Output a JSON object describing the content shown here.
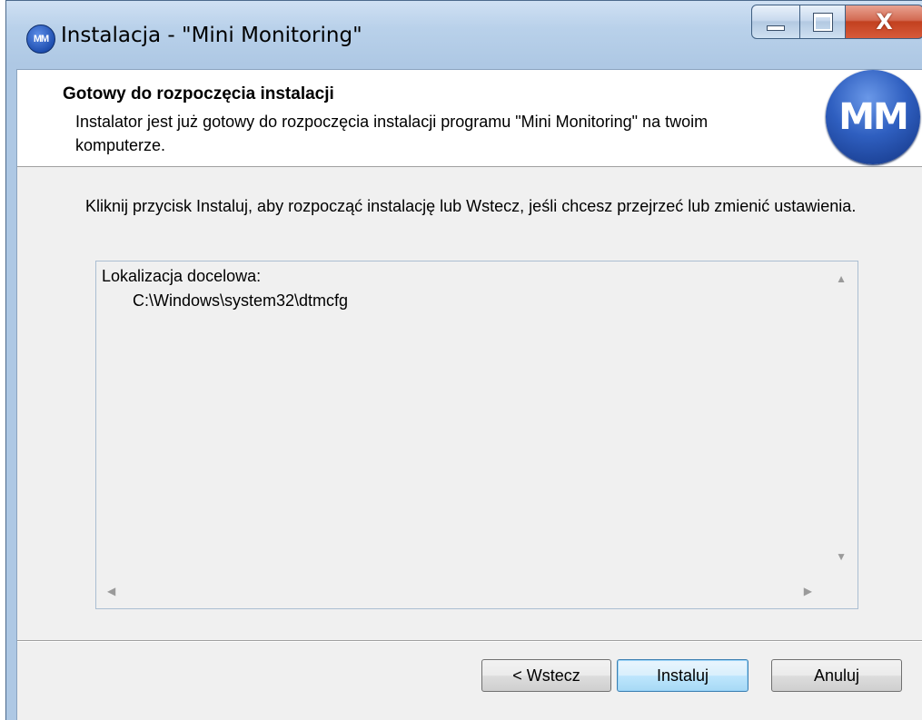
{
  "window": {
    "title": "Instalacja - \"Mini Monitoring\"",
    "app_icon_text": "MM",
    "controls": {
      "minimize": "minimize-icon",
      "maximize": "maximize-icon",
      "close": "close-icon"
    },
    "close_glyph": "X"
  },
  "header": {
    "title": "Gotowy do rozpoczęcia instalacji",
    "subtitle": "Instalator jest już gotowy do rozpoczęcia instalacji programu \"Mini Monitoring\" na twoim komputerze.",
    "logo_text": "MM"
  },
  "body": {
    "instruction": "Kliknij przycisk Instaluj, aby rozpocząć instalację lub Wstecz, jeśli chcesz przejrzeć lub zmienić ustawienia."
  },
  "memo": {
    "label": "Lokalizacja docelowa:",
    "value": "C:\\Windows\\system32\\dtmcfg"
  },
  "buttons": {
    "back": "< Wstecz",
    "install": "Instaluj",
    "cancel": "Anuluj"
  },
  "colors": {
    "title_bar": "#b9d1ea",
    "logo_blue": "#1f4fb0",
    "close_red": "#c2401f",
    "default_button_border": "#3c7fb1"
  }
}
